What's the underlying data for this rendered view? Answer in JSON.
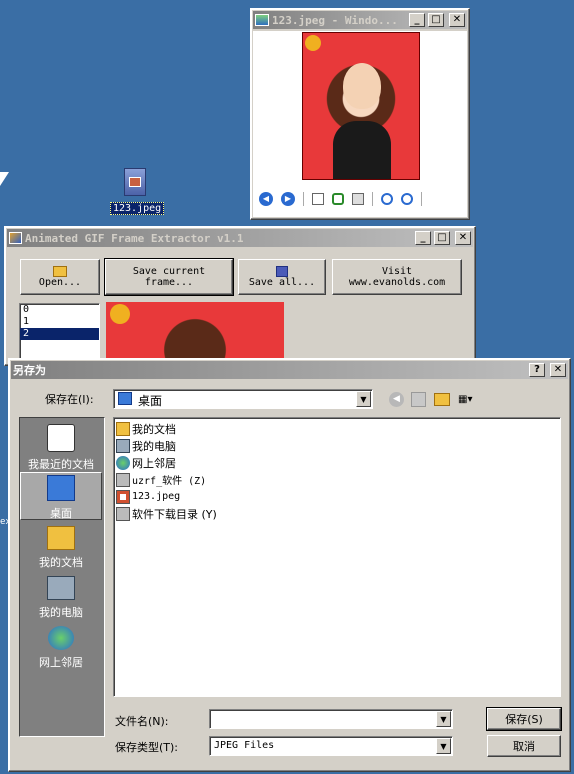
{
  "desktop": {
    "icon_label": "123.jpeg",
    "edge_label": "ex"
  },
  "viewer": {
    "title": "123.jpeg - Windo..."
  },
  "extractor": {
    "title": "Animated GIF Frame Extractor v1.1",
    "buttons": {
      "open": "Open...",
      "save_current_1": "Save current",
      "save_current_2": "frame...",
      "save_all": "Save all...",
      "visit_1": "Visit",
      "visit_2": "www.evanolds.com"
    },
    "frames": [
      "0",
      "1",
      "2"
    ],
    "selected_frame": "2"
  },
  "save_dialog": {
    "title": "另存为",
    "save_in_label": "保存在(I):",
    "save_in_value": "桌面",
    "places": [
      {
        "label": "我最近的文档",
        "icon": "recent-icon"
      },
      {
        "label": "桌面",
        "icon": "desktop-icon"
      },
      {
        "label": "我的文档",
        "icon": "documents-icon"
      },
      {
        "label": "我的电脑",
        "icon": "computer-icon"
      },
      {
        "label": "网上邻居",
        "icon": "network-icon"
      }
    ],
    "files": [
      {
        "name": "我的文档",
        "icon": "folder-icon"
      },
      {
        "name": "我的电脑",
        "icon": "computer-icon"
      },
      {
        "name": "网上邻居",
        "icon": "network-icon"
      },
      {
        "name": "uzrf_软件 (Z)",
        "icon": "network-drive-icon"
      },
      {
        "name": "123.jpeg",
        "icon": "image-file-icon"
      },
      {
        "name": "软件下载目录 (Y)",
        "icon": "network-drive-icon"
      }
    ],
    "filename_label": "文件名(N):",
    "filename_value": "",
    "filetype_label": "保存类型(T):",
    "filetype_value": "JPEG Files",
    "save_button": "保存(S)",
    "cancel_button": "取消"
  }
}
